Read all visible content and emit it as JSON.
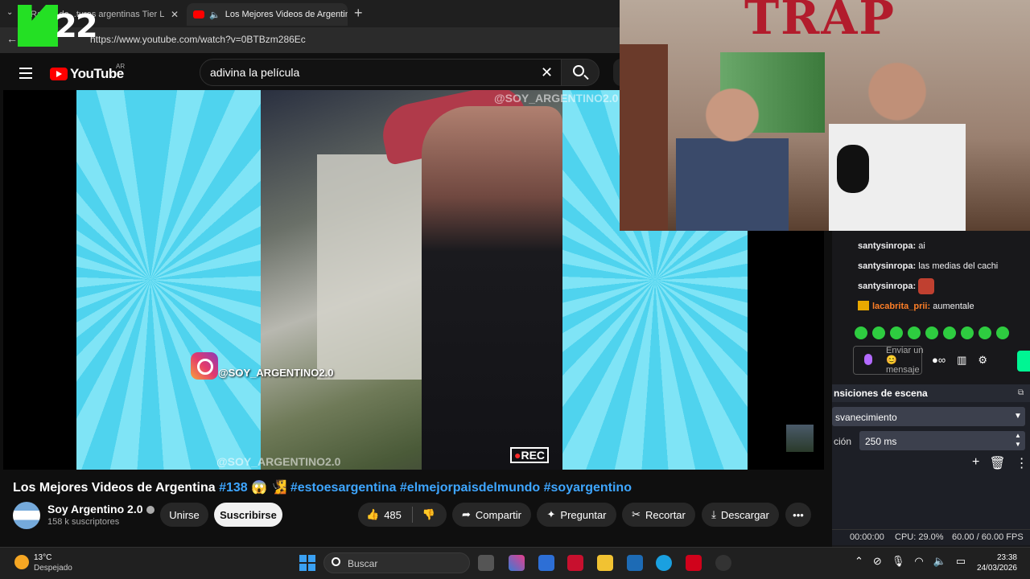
{
  "browser": {
    "tabs": [
      {
        "label": "Rate... de...turas argentinas Tier L"
      },
      {
        "label": "Los Mejores Videos de Argentina"
      }
    ],
    "new_tab_label": "+",
    "url": "https://www.youtube.com/watch?v=0BTBzm286Ec",
    "overlay_logo": "22"
  },
  "youtube": {
    "brand": "YouTube",
    "country_code": "AR",
    "search_value": "adivina la película",
    "video": {
      "watermark_top": "@SOY_ARGENTINO2.0",
      "watermark_bottom": "@SOY_ARGENTINO2.0",
      "instagram_handle": "@SOY_ARGENTINO2.0",
      "rec_label": "REC",
      "rec_dot": "●"
    },
    "title_main": "Los Mejores Videos de Argentina",
    "title_tags": "#138 😱 🧏 #estoesargentina #elmejorpaisdelmundo #soyargentino",
    "channel": {
      "name": "Soy Argentino 2.0",
      "subscribers": "158 k suscriptores",
      "join_label": "Unirse",
      "subscribe_label": "Suscribirse"
    },
    "actions": {
      "like_icon": "👍",
      "likes": "485",
      "dislike_icon": "👎",
      "share_label": "Compartir",
      "ask_label": "Preguntar",
      "clip_label": "Recortar",
      "download_label": "Descargar",
      "more_label": "•••"
    }
  },
  "webcam": {
    "wall_text": "TRAP"
  },
  "chat": {
    "messages": [
      {
        "user": "santysinropa:",
        "text": "ai"
      },
      {
        "user": "santysinropa:",
        "text": "las medias del cachi"
      },
      {
        "user": "santysinropa:",
        "text": ""
      },
      {
        "user": "lacabrita_prii:",
        "text": "aumentale"
      }
    ],
    "input_placeholder": "Enviar un 😊 mensaje",
    "bits_icon": "●∞",
    "store_icon": "▥",
    "settings_icon": "⚙"
  },
  "obs": {
    "panel_title": "nsiciones de escena",
    "transition_value": "svanecimiento",
    "duration_label": "ción",
    "duration_value": "250 ms",
    "add_icon": "+",
    "delete_icon": "🗑",
    "more_icon": "⋮",
    "time": "00:00:00",
    "cpu": "CPU: 29.0%",
    "fps": "60.00 / 60.00 FPS"
  },
  "taskbar": {
    "temperature": "13°C",
    "condition": "Despejado",
    "search_placeholder": "Buscar",
    "time": "23:38",
    "date": "24/03/2026"
  }
}
